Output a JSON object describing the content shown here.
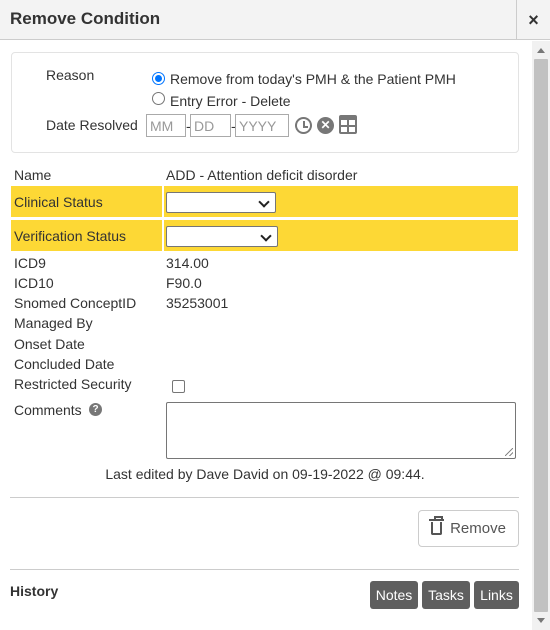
{
  "dialog": {
    "title": "Remove Condition",
    "close_glyph": "×"
  },
  "reason": {
    "label": "Reason",
    "options": [
      {
        "label": "Remove from today's PMH & the Patient PMH",
        "checked": true
      },
      {
        "label": "Entry Error - Delete",
        "checked": false
      }
    ]
  },
  "date_resolved": {
    "label": "Date Resolved",
    "month_placeholder": "MM",
    "day_placeholder": "DD",
    "year_placeholder": "YYYY",
    "month_value": "",
    "day_value": "",
    "year_value": "",
    "separator": "-",
    "icons": [
      "clock-icon",
      "clear-icon",
      "calendar-icon"
    ]
  },
  "details": {
    "name_label": "Name",
    "name_value": "ADD - Attention deficit disorder",
    "clinical_status_label": "Clinical Status",
    "clinical_status_value": "",
    "verification_status_label": "Verification Status",
    "verification_status_value": "",
    "icd9_label": "ICD9",
    "icd9_value": "314.00",
    "icd10_label": "ICD10",
    "icd10_value": "F90.0",
    "snomed_label": "Snomed ConceptID",
    "snomed_value": "35253001",
    "managed_by_label": "Managed By",
    "managed_by_value": "",
    "onset_label": "Onset Date",
    "onset_value": "",
    "concluded_label": "Concluded Date",
    "concluded_value": "",
    "restricted_label": "Restricted Security",
    "restricted_checked": false,
    "comments_label": "Comments",
    "comments_value": ""
  },
  "last_edited": "Last edited by Dave David on 09-19-2022 @ 09:44.",
  "remove_button": "Remove",
  "history": {
    "label": "History",
    "buttons": [
      "Notes",
      "Tasks",
      "Links"
    ]
  },
  "colors": {
    "highlight": "#fdd835",
    "radio_accent": "#0075ff",
    "dark_button": "#5f5f5f"
  }
}
